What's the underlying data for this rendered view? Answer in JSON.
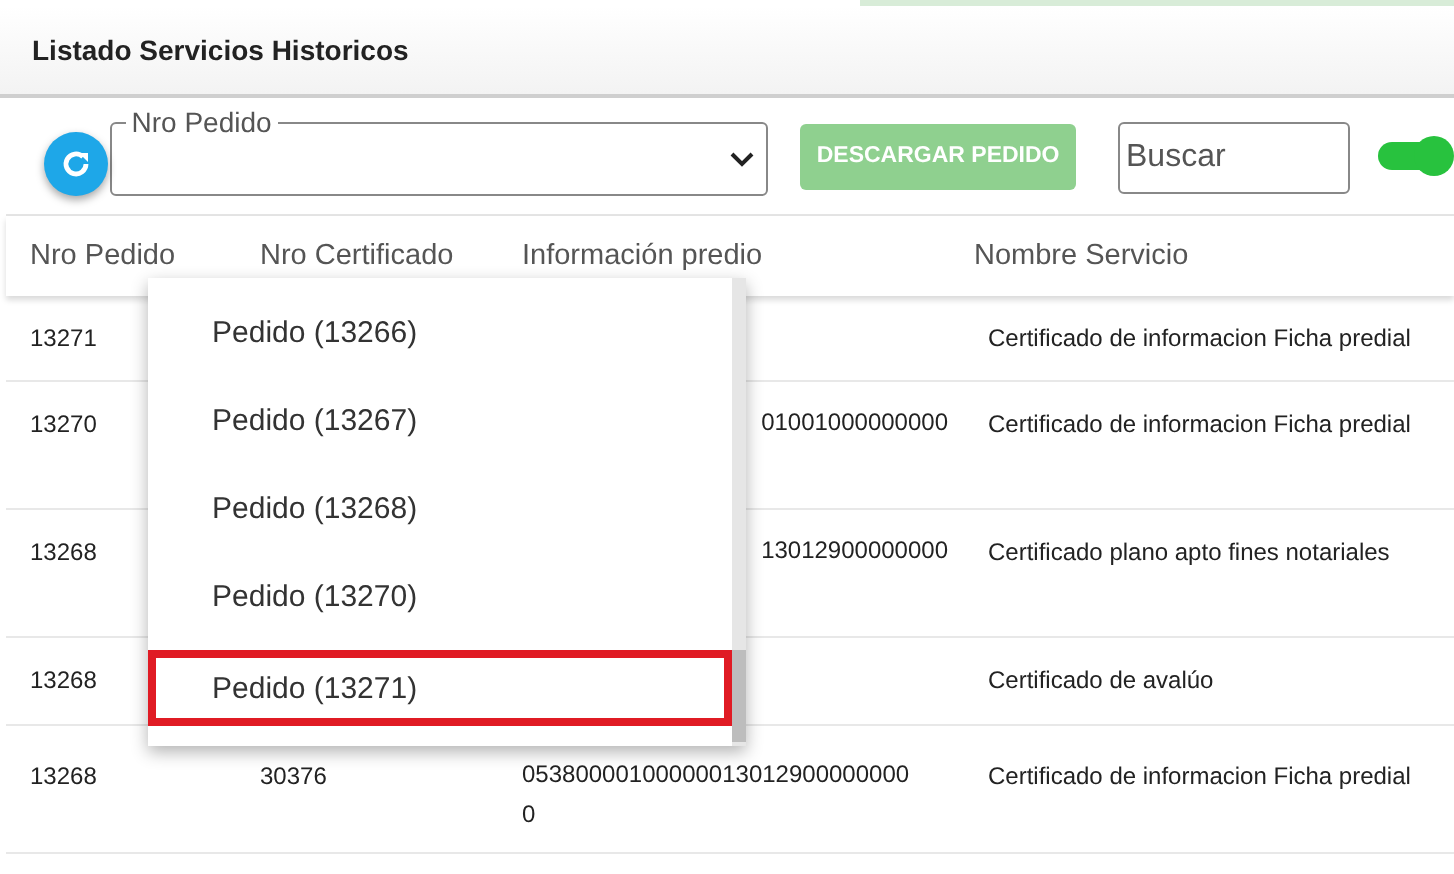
{
  "header": {
    "title": "Listado Servicios Historicos"
  },
  "toolbar": {
    "select": {
      "label": "Nro Pedido"
    },
    "download_button": {
      "label": "DESCARGAR PEDIDO",
      "disabled": true
    },
    "search": {
      "placeholder": "Buscar"
    },
    "toggle": {
      "on": true
    }
  },
  "table": {
    "columns": [
      "Nro Pedido",
      "Nro Certificado",
      "Información predio",
      "Nombre Servicio"
    ],
    "rows": [
      {
        "cells": [
          "13271",
          "",
          "",
          "Certificado de informacion Ficha predial"
        ]
      },
      {
        "cells": [
          "13270",
          "",
          "01001000000000",
          "Certificado de informacion Ficha predial"
        ],
        "info_clipped": true
      },
      {
        "cells": [
          "13268",
          "",
          "13012900000000",
          "Certificado plano apto fines notariales"
        ],
        "info_clipped": true
      },
      {
        "cells": [
          "13268",
          "",
          "",
          "Certificado de avalúo"
        ]
      },
      {
        "cells": [
          "13268",
          "30376",
          "05380000100000013012900000000 0",
          "Certificado de informacion Ficha predial"
        ]
      }
    ]
  },
  "dropdown": {
    "items": [
      {
        "label": "Pedido (13266)",
        "highlighted": false
      },
      {
        "label": "Pedido (13267)",
        "highlighted": false
      },
      {
        "label": "Pedido (13268)",
        "highlighted": false
      },
      {
        "label": "Pedido (13270)",
        "highlighted": false
      },
      {
        "label": "Pedido (13271)",
        "highlighted": true
      }
    ]
  }
}
